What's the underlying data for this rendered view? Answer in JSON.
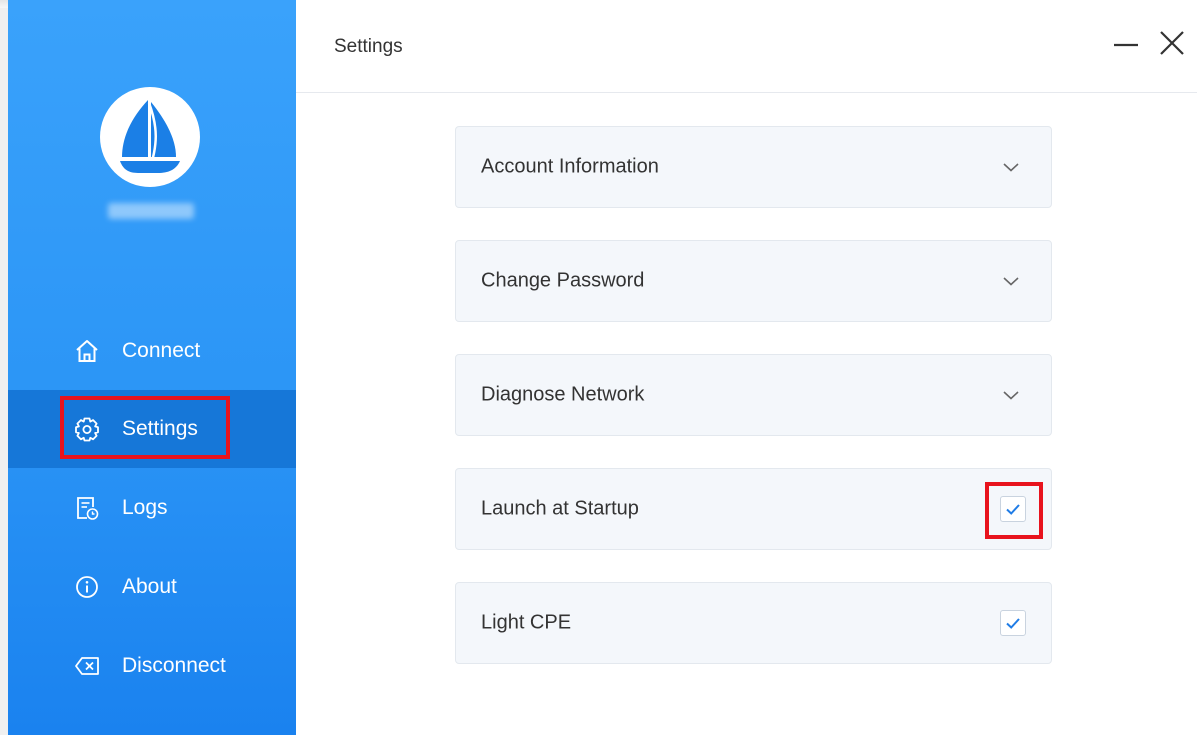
{
  "app": {
    "title": "Settings"
  },
  "sidebar": {
    "avatar_icon": "sailboat-icon",
    "items": [
      {
        "label": "Connect",
        "icon": "home-icon"
      },
      {
        "label": "Settings",
        "icon": "gear-icon",
        "active": true
      },
      {
        "label": "Logs",
        "icon": "log-icon"
      },
      {
        "label": "About",
        "icon": "info-icon"
      },
      {
        "label": "Disconnect",
        "icon": "disconnect-icon"
      }
    ]
  },
  "settings": {
    "rows": [
      {
        "label": "Account Information",
        "control": "chevron-down-icon"
      },
      {
        "label": "Change Password",
        "control": "chevron-down-icon"
      },
      {
        "label": "Diagnose Network",
        "control": "chevron-down-icon"
      },
      {
        "label": "Launch at Startup",
        "control": "checkbox",
        "checked": true
      },
      {
        "label": "Light CPE",
        "control": "checkbox",
        "checked": true
      }
    ]
  },
  "colors": {
    "sidebar_top": "#3aa2fb",
    "sidebar_bottom": "#1a82ef",
    "sidebar_active": "#1677d8",
    "check_blue": "#1f7ce6",
    "highlight_red": "#e8131d"
  }
}
